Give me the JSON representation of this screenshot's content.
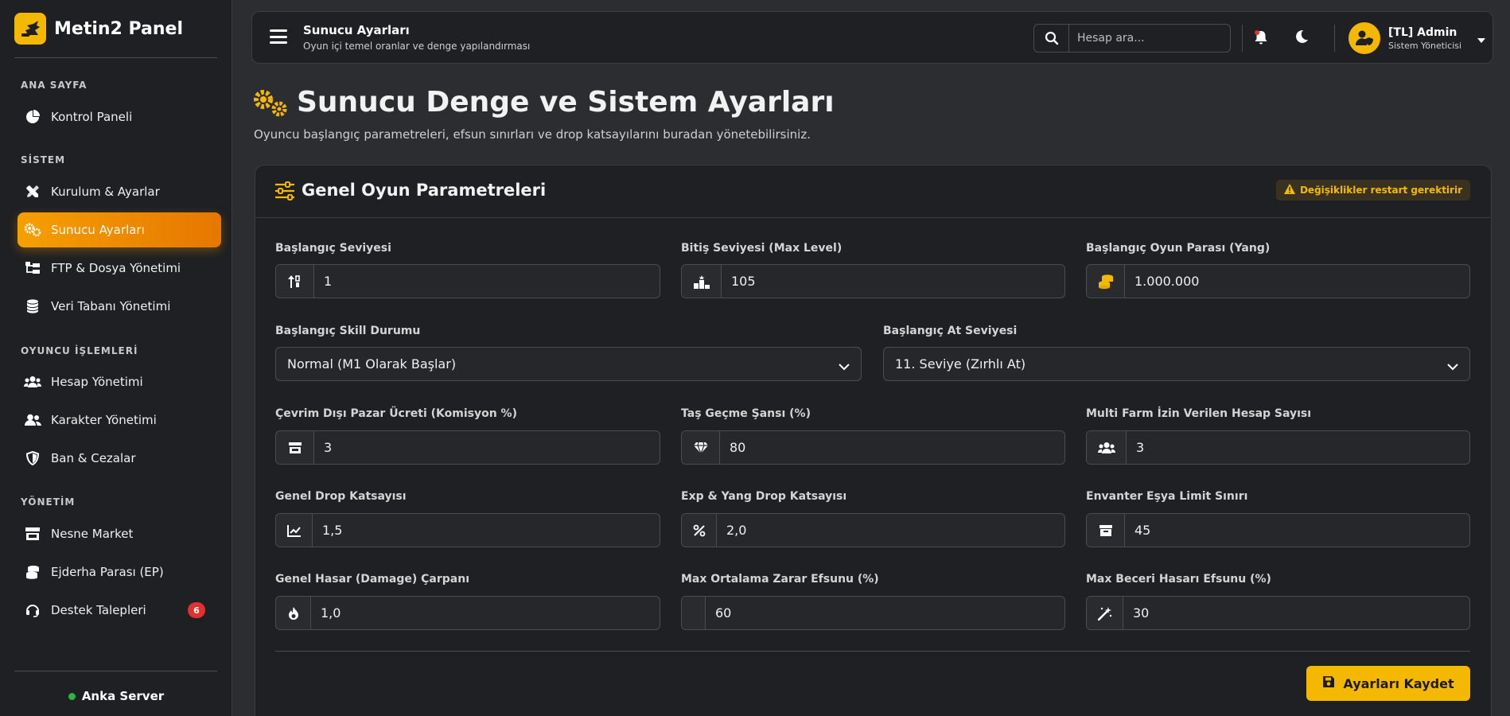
{
  "brand": {
    "title": "Metin2 Panel"
  },
  "sidebar": {
    "sections": [
      {
        "label": "ANA SAYFA"
      },
      {
        "label": "SİSTEM"
      },
      {
        "label": "OYUNCU İŞLEMLERİ"
      },
      {
        "label": "YÖNETİM"
      }
    ],
    "items": [
      {
        "label": "Kontrol Paneli"
      },
      {
        "label": "Kurulum & Ayarlar"
      },
      {
        "label": "Sunucu Ayarları"
      },
      {
        "label": "FTP & Dosya Yönetimi"
      },
      {
        "label": "Veri Tabanı Yönetimi"
      },
      {
        "label": "Hesap Yönetimi"
      },
      {
        "label": "Karakter Yönetimi"
      },
      {
        "label": "Ban & Cezalar"
      },
      {
        "label": "Nesne Market"
      },
      {
        "label": "Ejderha Parası (EP)"
      },
      {
        "label": "Destek Talepleri",
        "badge": "6"
      }
    ],
    "server": "Anka Server"
  },
  "topbar": {
    "title": "Sunucu Ayarları",
    "subtitle": "Oyun içi temel oranlar ve denge yapılandırması",
    "search_placeholder": "Hesap ara...",
    "user_name": "[TL] Admin",
    "user_role": "Sistem Yöneticisi"
  },
  "page": {
    "title": "Sunucu Denge ve Sistem Ayarları",
    "subtitle": "Oyuncu başlangıç parametreleri, efsun sınırları ve drop katsayılarını buradan yönetebilirsiniz."
  },
  "card": {
    "title": "Genel Oyun Parametreleri",
    "warning": "Değişiklikler restart gerektirir",
    "fields": {
      "start_level": {
        "label": "Başlangıç Seviyesi",
        "value": "1"
      },
      "max_level": {
        "label": "Bitiş Seviyesi (Max Level)",
        "value": "105"
      },
      "start_yang": {
        "label": "Başlangıç Oyun Parası (Yang)",
        "value": "1.000.000"
      },
      "skill_state": {
        "label": "Başlangıç Skill Durumu",
        "value": "Normal (M1 Olarak Başlar)"
      },
      "horse_level": {
        "label": "Başlangıç At Seviyesi",
        "value": "11. Seviye (Zırhlı At)"
      },
      "market_fee": {
        "label": "Çevrim Dışı Pazar Ücreti (Komisyon %)",
        "value": "3"
      },
      "stone_chance": {
        "label": "Taş Geçme Şansı (%)",
        "value": "80"
      },
      "multi_farm": {
        "label": "Multi Farm İzin Verilen Hesap Sayısı",
        "value": "3"
      },
      "drop_rate": {
        "label": "Genel Drop Katsayısı",
        "value": "1,5"
      },
      "exp_yang_rate": {
        "label": "Exp & Yang Drop Katsayısı",
        "value": "2,0"
      },
      "inventory_limit": {
        "label": "Envanter Eşya Limit Sınırı",
        "value": "45"
      },
      "damage_mult": {
        "label": "Genel Hasar (Damage) Çarpanı",
        "value": "1,0"
      },
      "max_avg_damage": {
        "label": "Max Ortalama Zarar Efsunu (%)",
        "value": "60"
      },
      "max_skill_damage": {
        "label": "Max Beceri Hasarı Efsunu (%)",
        "value": "30"
      }
    },
    "save_label": "Ayarları Kaydet"
  },
  "colors": {
    "accent": "#f5b800",
    "active_nav": "#f08c00",
    "badge": "#e03131",
    "online": "#2fb344"
  }
}
